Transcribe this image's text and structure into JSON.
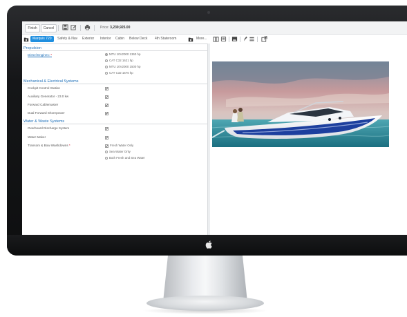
{
  "toolbar": {
    "finish_label": "Finish",
    "cancel_label": "Cancel",
    "price_label": "Price:",
    "price_value": "3,239,925.00"
  },
  "tabs": {
    "active": "Marquis 720",
    "items": [
      "Safety & Nav",
      "Exterior",
      "Interior",
      "Cabin",
      "Below Deck",
      "4th Stateroom"
    ],
    "more": "More..."
  },
  "form": {
    "propulsion": {
      "title": "Propulsion",
      "field_label": "Diesel Engines:",
      "required_mark": "*",
      "options": [
        "MTU 10V2000 1360 hp",
        "CAT C32 1621 hp",
        "MTU 10V2000 1500 hp",
        "CAT C32 1676 hp"
      ],
      "selected_index": 0
    },
    "mechanical": {
      "title": "Mechanical & Electrical Systems",
      "fields": [
        {
          "label": "Cockpit Control Station",
          "checked": true
        },
        {
          "label": "Auxiliary Generator - 23.0 kw",
          "checked": true
        },
        {
          "label": "Forward Cablemaster",
          "checked": true
        },
        {
          "label": "Dual Forward Shorepower",
          "checked": true
        }
      ]
    },
    "water": {
      "title": "Water & Waste Systems",
      "fields": [
        {
          "label": "Overboard Discharge System",
          "checked": true
        },
        {
          "label": "Water Maker",
          "checked": true
        }
      ],
      "washdowns_label": "Transom & Bow Washdowns",
      "required_mark": "*",
      "washdown_options": [
        "Fresh Water Only",
        "Sea Water Only",
        "Both Fresh and Sea Water"
      ],
      "selected_index": 0
    }
  },
  "check_mark": "✔",
  "colors": {
    "accent": "#1f8fe0",
    "section_title": "#1e6fb8",
    "required": "#d0021b",
    "hull_stripe": "#1d3f9e"
  },
  "icons": [
    "save-icon",
    "edit-icon",
    "print-icon",
    "folder-icon",
    "book-icon",
    "copy-icon",
    "image-icon",
    "paint-icon",
    "layers-icon",
    "external-link-icon",
    "apple-logo-icon"
  ]
}
